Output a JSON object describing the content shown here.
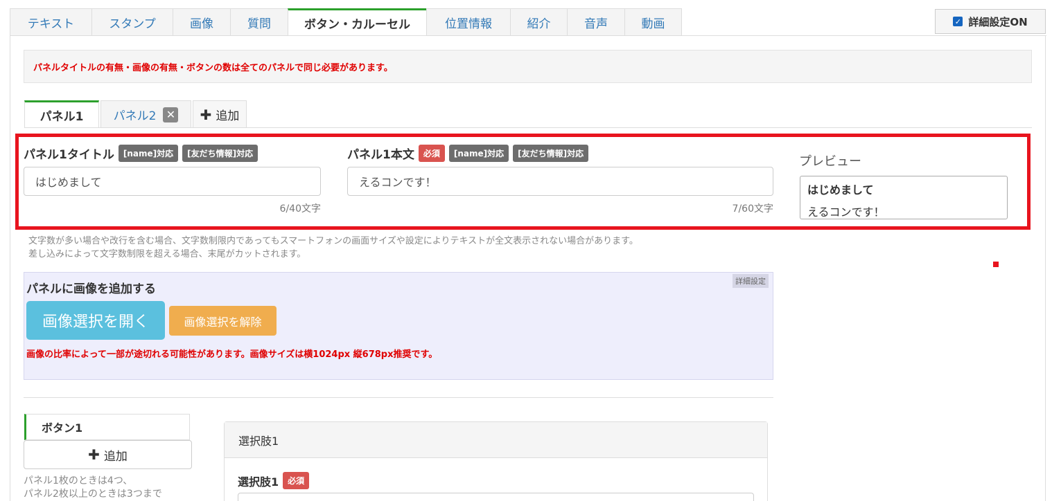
{
  "top_tabs": [
    {
      "label": "テキスト"
    },
    {
      "label": "スタンプ"
    },
    {
      "label": "画像"
    },
    {
      "label": "質問"
    },
    {
      "label": "ボタン・カルーセル"
    },
    {
      "label": "位置情報"
    },
    {
      "label": "紹介"
    },
    {
      "label": "音声"
    },
    {
      "label": "動画"
    }
  ],
  "advanced_toggle": {
    "label": "詳細設定ON",
    "checked": true
  },
  "alert_text": "パネルタイトルの有無・画像の有無・ボタンの数は全てのパネルで同じ必要があります。",
  "panel_tabs": {
    "panel1": "パネル1",
    "panel2": "パネル2",
    "add": "追加"
  },
  "panel_title": {
    "label": "パネル1タイトル",
    "badges": [
      "[name]対応",
      "[友だち情報]対応"
    ],
    "value": "はじめまして",
    "counter": "6/40文字"
  },
  "panel_body": {
    "label": "パネル1本文",
    "required": "必須",
    "badges": [
      "[name]対応",
      "[友だち情報]対応"
    ],
    "value": "えるコンです！",
    "counter": "7/60文字"
  },
  "preview": {
    "label": "プレビュー",
    "title": "はじめまして",
    "body": "えるコンです！"
  },
  "notes": {
    "line1": "文字数が多い場合や改行を含む場合、文字数制限内であってもスマートフォンの画面サイズや設定によりテキストが全文表示されない場合があります。",
    "line2": "差し込みによって文字数制限を超える場合、末尾がカットされます。"
  },
  "image_panel": {
    "tag": "詳細設定",
    "heading": "パネルに画像を追加する",
    "open_button": "画像選択を開く",
    "clear_button": "画像選択を解除",
    "warning": "画像の比率によって一部が途切れる可能性があります。画像サイズは横1024px 縦678px推奨です。"
  },
  "buttons_section": {
    "tab_label": "ボタン1",
    "add_label": "追加",
    "note_line1": "パネル1枚のときは4つ、",
    "note_line2": "パネル2枚以上のときは3つまで"
  },
  "choice": {
    "header": "選択肢1",
    "label": "選択肢1",
    "required": "必須"
  },
  "colors": {
    "accent_green": "#2ca02c",
    "highlight_red": "#e8141e",
    "info_blue": "#5bc0de",
    "warning_orange": "#f0ad4e"
  }
}
